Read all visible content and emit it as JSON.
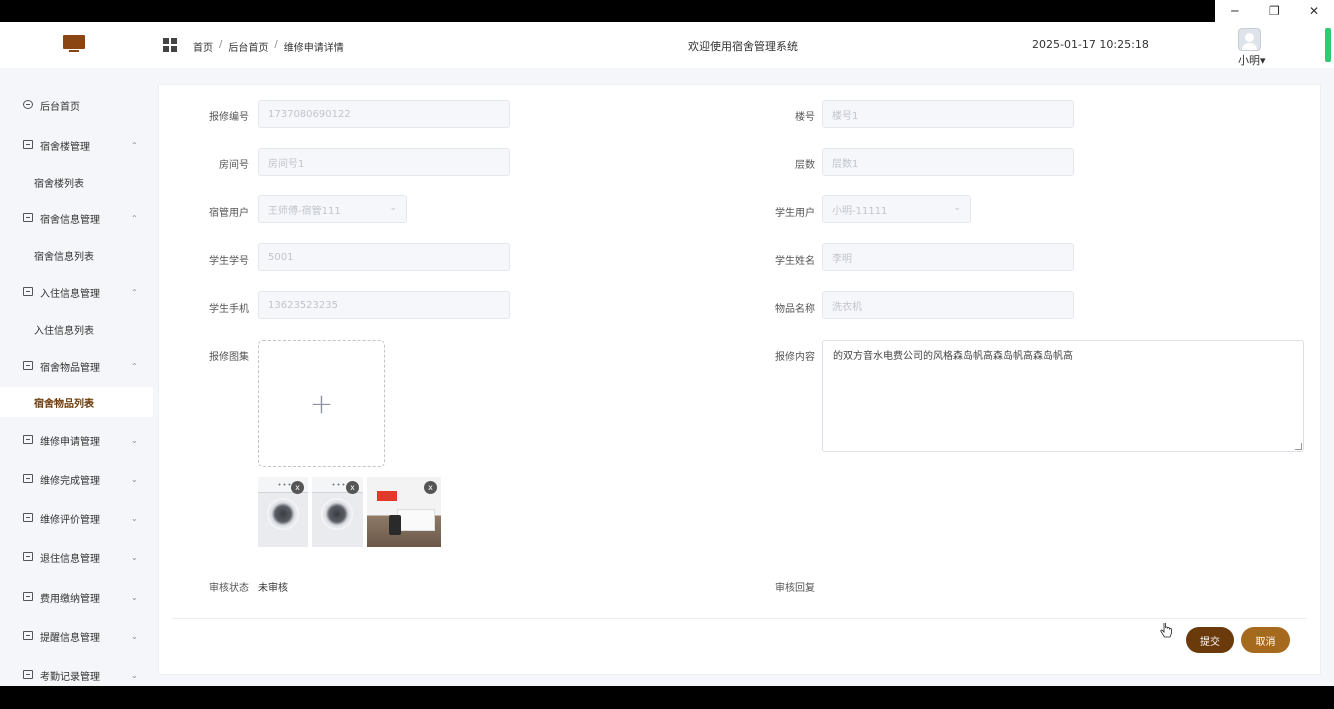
{
  "window": {
    "minimize_glyph": "─",
    "restore_glyph": "❐",
    "close_glyph": "✕"
  },
  "header": {
    "breadcrumb": [
      "首页",
      "后台首页",
      "维修申请详情"
    ],
    "breadcrumb_sep": "/",
    "welcome": "欢迎使用宿舍管理系统",
    "datetime": "2025-01-17 10:25:18",
    "user": "小明",
    "user_caret": "▾"
  },
  "sidebar": {
    "items": [
      {
        "label": "后台首页",
        "icon": "clock-icon",
        "chevron": ""
      },
      {
        "label": "宿舍楼管理",
        "icon": "menu-icon",
        "chevron": "⌃"
      },
      {
        "label": "宿舍楼列表",
        "sub": true
      },
      {
        "label": "宿舍信息管理",
        "icon": "menu-icon",
        "chevron": "⌃"
      },
      {
        "label": "宿舍信息列表",
        "sub": true
      },
      {
        "label": "入住信息管理",
        "icon": "menu-icon",
        "chevron": "⌃"
      },
      {
        "label": "入住信息列表",
        "sub": true
      },
      {
        "label": "宿舍物品管理",
        "icon": "menu-icon",
        "chevron": "⌃"
      },
      {
        "label": "宿舍物品列表",
        "sub": true,
        "active": true
      },
      {
        "label": "维修申请管理",
        "icon": "menu-icon",
        "chevron": "⌄"
      },
      {
        "label": "维修完成管理",
        "icon": "menu-icon",
        "chevron": "⌄"
      },
      {
        "label": "维修评价管理",
        "icon": "menu-icon",
        "chevron": "⌄"
      },
      {
        "label": "退住信息管理",
        "icon": "menu-icon",
        "chevron": "⌄"
      },
      {
        "label": "费用缴纳管理",
        "icon": "menu-icon",
        "chevron": "⌄"
      },
      {
        "label": "提醒信息管理",
        "icon": "menu-icon",
        "chevron": "⌄"
      },
      {
        "label": "考勤记录管理",
        "icon": "menu-icon",
        "chevron": "⌄"
      }
    ]
  },
  "form": {
    "repair_no": {
      "label": "报修编号",
      "value": "1737080690122"
    },
    "building_no": {
      "label": "楼号",
      "value": "楼号1"
    },
    "room_no": {
      "label": "房间号",
      "value": "房间号1"
    },
    "floor": {
      "label": "层数",
      "value": "层数1"
    },
    "manager_user": {
      "label": "宿管用户",
      "value": "王师傅-宿管111"
    },
    "student_user": {
      "label": "学生用户",
      "value": "小明-11111"
    },
    "student_id": {
      "label": "学生学号",
      "value": "5001"
    },
    "student_name": {
      "label": "学生姓名",
      "value": "李明"
    },
    "student_phone": {
      "label": "学生手机",
      "value": "13623523235"
    },
    "item_name": {
      "label": "物品名称",
      "value": "洗衣机"
    },
    "gallery": {
      "label": "报修图集",
      "plus": "+",
      "delete_glyph": "x"
    },
    "content": {
      "label": "报修内容",
      "value": "的双方音水电费公司的风格森岛帆高森岛帆高森岛帆高"
    },
    "audit_status": {
      "label": "审核状态",
      "value": "未审核"
    },
    "audit_reply": {
      "label": "审核回复",
      "value": ""
    }
  },
  "actions": {
    "submit": "提交",
    "cancel": "取消"
  },
  "colors": {
    "primary": "#6b3a0a",
    "secondary": "#a66a1f",
    "logo": "#8b4513"
  }
}
